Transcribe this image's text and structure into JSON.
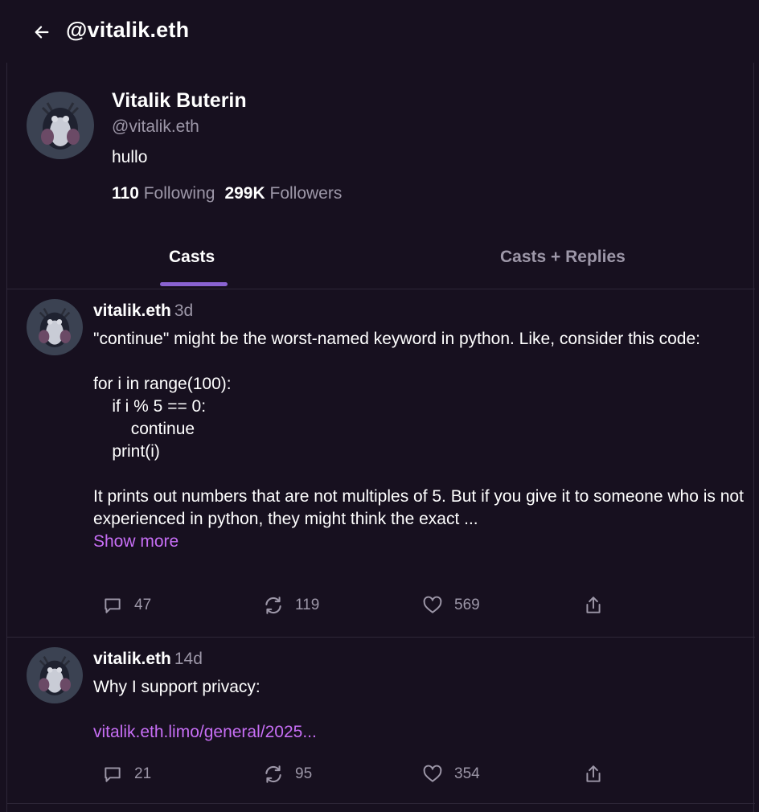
{
  "header": {
    "title": "@vitalik.eth"
  },
  "profile": {
    "name": "Vitalik Buterin",
    "handle": "@vitalik.eth",
    "bio": "hullo",
    "following_count": "110",
    "following_label": "Following",
    "followers_count": "299K",
    "followers_label": "Followers"
  },
  "tabs": [
    {
      "label": "Casts",
      "active": true
    },
    {
      "label": "Casts + Replies",
      "active": false
    }
  ],
  "casts": [
    {
      "author": "vitalik.eth",
      "time": "3d",
      "body": "\"continue\" might be the worst-named keyword in python. Like, consider this code:\n\nfor i in range(100):\n    if i % 5 == 0:\n        continue\n    print(i)\n\nIt prints out numbers that are not multiples of 5. But if you give it to someone who is not experienced in python, they might think the exact ...",
      "show_more": "Show more",
      "replies": "47",
      "recasts": "119",
      "likes": "569"
    },
    {
      "author": "vitalik.eth",
      "time": "14d",
      "body": "Why I support privacy:",
      "link": "vitalik.eth.limo/general/2025...",
      "replies": "21",
      "recasts": "95",
      "likes": "354"
    }
  ],
  "colors": {
    "background": "#17101f",
    "accent": "#8a63d2",
    "link": "#c76ef5",
    "muted": "#9d97a8"
  },
  "icons": {
    "back": "arrow-left-icon",
    "reply": "comment-icon",
    "recast": "recast-icon",
    "like": "heart-icon",
    "share": "share-icon"
  }
}
